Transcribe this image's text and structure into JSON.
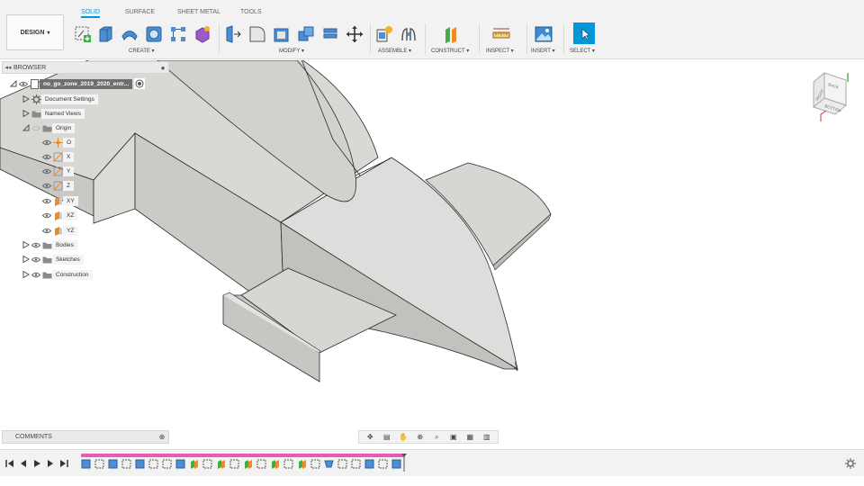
{
  "workspace": {
    "label": "DESIGN"
  },
  "tabs": [
    {
      "label": "SOLID",
      "active": true
    },
    {
      "label": "SURFACE",
      "active": false
    },
    {
      "label": "SHEET METAL",
      "active": false
    },
    {
      "label": "TOOLS",
      "active": false
    }
  ],
  "groups": [
    {
      "label": "CREATE ▾"
    },
    {
      "label": "MODIFY ▾"
    },
    {
      "label": "ASSEMBLE ▾"
    },
    {
      "label": "CONSTRUCT ▾"
    },
    {
      "label": "INSPECT ▾"
    },
    {
      "label": "INSERT ▾"
    },
    {
      "label": "SELECT ▾"
    }
  ],
  "viewcube": {
    "faces": [
      "BACK",
      "RIGHT",
      "BOTTOM"
    ]
  },
  "browser": {
    "title": "BROWSER",
    "root": "no_go_zone_2019_2020_entr...",
    "items": [
      {
        "label": "Document Settings"
      },
      {
        "label": "Named Views"
      },
      {
        "label": "Origin"
      },
      {
        "label": "O"
      },
      {
        "label": "X"
      },
      {
        "label": "Y"
      },
      {
        "label": "Z"
      },
      {
        "label": "XY"
      },
      {
        "label": "XZ"
      },
      {
        "label": "YZ"
      },
      {
        "label": "Bodies"
      },
      {
        "label": "Sketches"
      },
      {
        "label": "Construction"
      }
    ]
  },
  "comments": {
    "title": "COMMENTS"
  },
  "colors": {
    "accent": "#0696d7",
    "timeline_track": "#e85ab4",
    "model_face": "#d6d5d2",
    "model_edge": "#2a2a2a"
  }
}
